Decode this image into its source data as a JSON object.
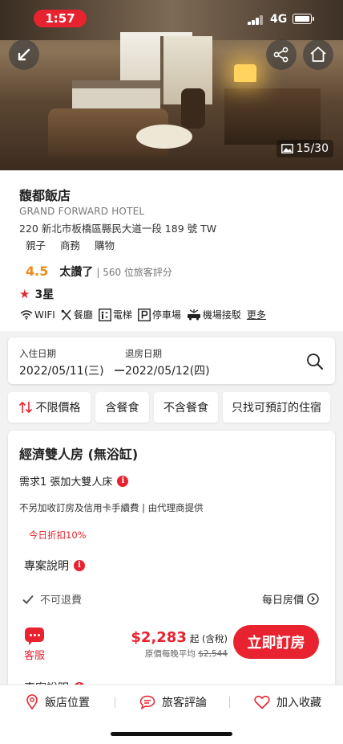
{
  "status_bar": {
    "time": "1:57",
    "network": "4G"
  },
  "hero": {
    "photo_count": "15/30",
    "back_icon": "back-arrow-icon",
    "share_icon": "share-icon",
    "home_icon": "home-icon"
  },
  "hotel": {
    "name": "馥都飯店",
    "name_en": "GRAND FORWARD HOTEL",
    "address": "220 新北市板橋區縣民大道一段 189 號 TW",
    "tags": [
      "親子",
      "商務",
      "購物"
    ],
    "score": "4.5",
    "verdict": "太讚了",
    "reviews": "| 560 位旅客評分",
    "stars": "3星",
    "amenities": [
      "WIFI",
      "餐廳",
      "電梯",
      "停車場",
      "機場接駁"
    ],
    "more": "更多"
  },
  "dates": {
    "checkin_label": "入住日期",
    "checkin": "2022/05/11(三)",
    "checkout_label": "退房日期",
    "checkout": "2022/05/12(四)"
  },
  "filters": [
    "不限價格",
    "含餐食",
    "不含餐食",
    "只找可預訂的住宿"
  ],
  "room": {
    "title": "經濟雙人房 (無浴缸)",
    "bed": "需求1 張加大雙人床",
    "fee_note": "不另加收訂房及信用卡手續費 | 由代理商提供",
    "discount": "今日折扣10%",
    "plan_desc": "專案說明",
    "refund": "不可退費",
    "daily_price": "每日房價",
    "cs_label": "客服",
    "price": "$2,283",
    "price_suffix": "起 (含稅)",
    "orig_prefix": "原價每晚平均",
    "orig_price": "$2,544",
    "book": "立即訂房",
    "plan_desc2": "專案說明"
  },
  "bottom_bar": {
    "location": "飯店位置",
    "reviews": "旅客評論",
    "favorite": "加入收藏"
  },
  "colors": {
    "accent": "#e8232f",
    "score": "#f08a17"
  }
}
